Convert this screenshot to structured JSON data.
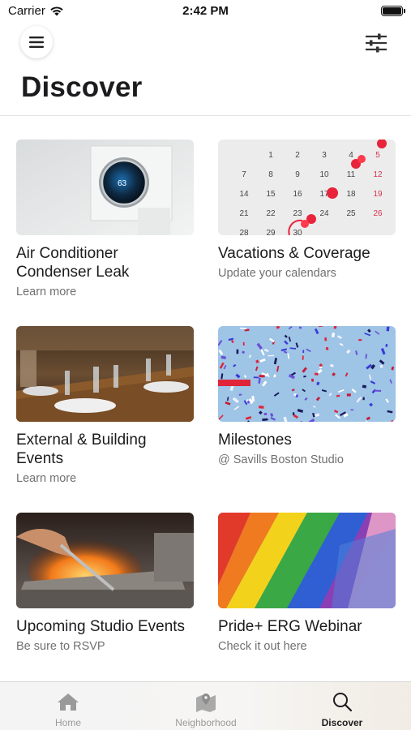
{
  "status_bar": {
    "carrier": "Carrier",
    "time": "2:42 PM",
    "wifi_icon": "wifi-icon",
    "battery_icon": "battery-icon"
  },
  "header": {
    "menu_icon": "hamburger-menu-icon",
    "filter_icon": "sliders-filter-icon",
    "title": "Discover"
  },
  "cards": [
    {
      "title": "Air Conditioner Condenser Leak",
      "subtitle": "Learn more",
      "image": "thermostat-photo",
      "thermostat_reading": "63"
    },
    {
      "title": "Vacations & Coverage",
      "subtitle": "Update your calendars",
      "image": "calendar-pins-photo",
      "calendar_rows": [
        [
          "",
          "1",
          "2",
          "3",
          "4",
          "5"
        ],
        [
          "7",
          "8",
          "9",
          "10",
          "11",
          "12"
        ],
        [
          "14",
          "15",
          "16",
          "17",
          "18",
          "19"
        ],
        [
          "21",
          "22",
          "23",
          "24",
          "25",
          "26"
        ],
        [
          "28",
          "29",
          "30",
          "",
          "",
          ""
        ]
      ]
    },
    {
      "title": "External & Building Events",
      "subtitle": "Learn more",
      "image": "restaurant-table-photo"
    },
    {
      "title": "Milestones",
      "subtitle": "@ Savills Boston Studio",
      "image": "confetti-photo"
    },
    {
      "title": "Upcoming Studio Events",
      "subtitle": "Be sure to RSVP",
      "image": "grill-photo"
    },
    {
      "title": "Pride+ ERG Webinar",
      "subtitle": "Check it out here",
      "image": "rainbow-flag-photo"
    }
  ],
  "tab_bar": {
    "tabs": [
      {
        "label": "Home",
        "icon": "home-icon",
        "active": false
      },
      {
        "label": "Neighborhood",
        "icon": "map-pin-icon",
        "active": false
      },
      {
        "label": "Discover",
        "icon": "search-icon",
        "active": true
      }
    ]
  },
  "colors": {
    "title_text": "#1c1c1e",
    "subtitle_text": "#707070",
    "tab_inactive": "#9a9a9a",
    "tab_active": "#1c1c1e"
  }
}
